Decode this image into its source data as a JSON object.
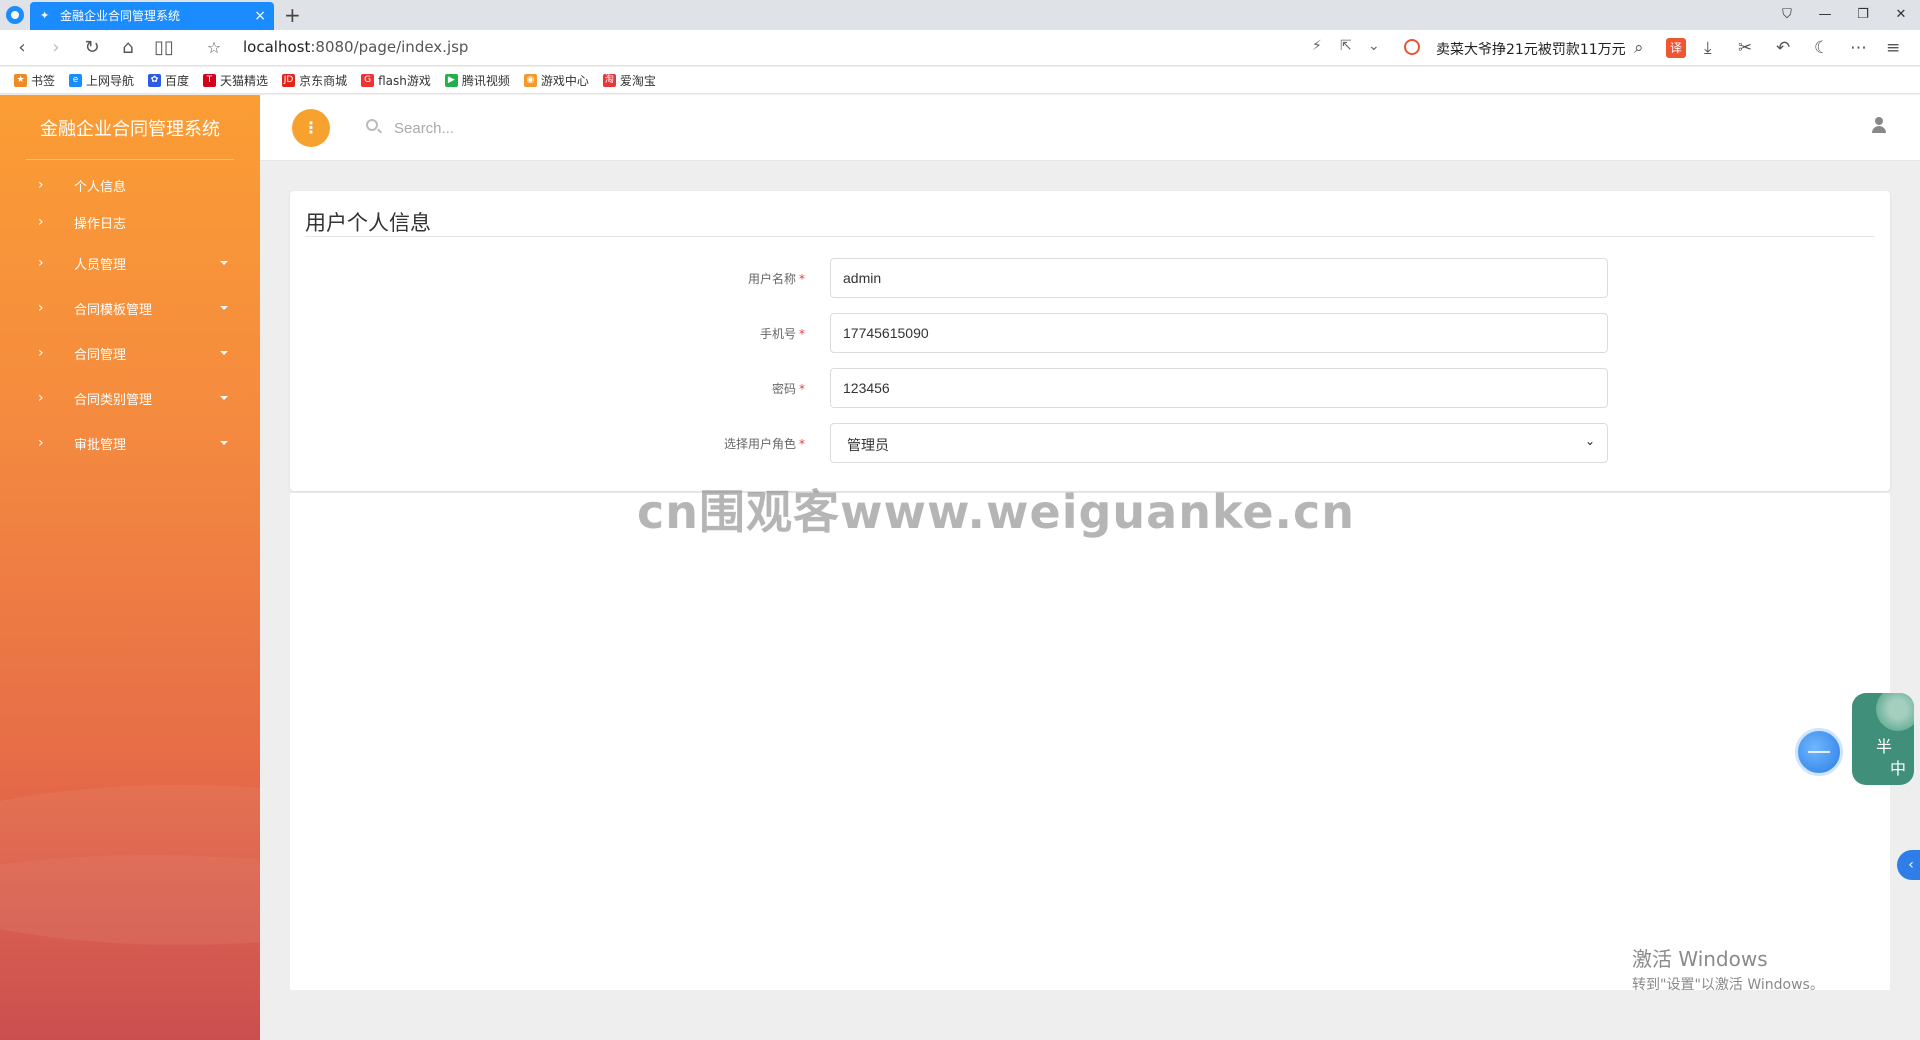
{
  "browser": {
    "tab_title": "金融企业合同管理系统",
    "new_tab": "+",
    "url_host": "localhost",
    "url_rest": ":8080/page/index.jsp",
    "news_ticker": "卖菜大爷挣21元被罚款11万元",
    "translate_label": "译",
    "bookmarks": [
      {
        "label": "书签",
        "color": "#f08a24",
        "glyph": "★"
      },
      {
        "label": "上网导航",
        "color": "#1a8cff",
        "glyph": "e"
      },
      {
        "label": "百度",
        "color": "#2d5be3",
        "glyph": "✿"
      },
      {
        "label": "天猫精选",
        "color": "#d0021b",
        "glyph": "T"
      },
      {
        "label": "京东商城",
        "color": "#e1251b",
        "glyph": "JD"
      },
      {
        "label": "flash游戏",
        "color": "#e33",
        "glyph": "G"
      },
      {
        "label": "腾讯视频",
        "color": "#20b14a",
        "glyph": "▶"
      },
      {
        "label": "游戏中心",
        "color": "#f39a2a",
        "glyph": "◉"
      },
      {
        "label": "爱淘宝",
        "color": "#e4393c",
        "glyph": "淘"
      }
    ]
  },
  "sidebar": {
    "brand": "金融企业合同管理系统",
    "items": [
      {
        "label": "个人信息",
        "has_submenu": false
      },
      {
        "label": "操作日志",
        "has_submenu": false
      },
      {
        "label": "人员管理",
        "has_submenu": true
      },
      {
        "label": "合同模板管理",
        "has_submenu": true
      },
      {
        "label": "合同管理",
        "has_submenu": true
      },
      {
        "label": "合同类别管理",
        "has_submenu": true
      },
      {
        "label": "审批管理",
        "has_submenu": true
      }
    ]
  },
  "topbar": {
    "search_placeholder": "Search..."
  },
  "form": {
    "title": "用户个人信息",
    "required_mark": "*",
    "fields": {
      "username": {
        "label": "用户名称",
        "value": "admin"
      },
      "phone": {
        "label": "手机号",
        "value": "17745615090"
      },
      "password": {
        "label": "密码",
        "value": "123456"
      },
      "role": {
        "label": "选择用户角色",
        "value": "管理员"
      }
    }
  },
  "overlay": {
    "watermark": "cn围观客www.weiguanke.cn",
    "activate_title": "激活 Windows",
    "activate_sub": "转到\"设置\"以激活 Windows。",
    "badge_t1": "半",
    "badge_t2": "中"
  },
  "colors": {
    "sidebar_top": "#fb9d34",
    "sidebar_bottom": "#c94546",
    "accent": "#f7a22f",
    "tab_blue": "#1a8cff",
    "required": "#e64242"
  }
}
